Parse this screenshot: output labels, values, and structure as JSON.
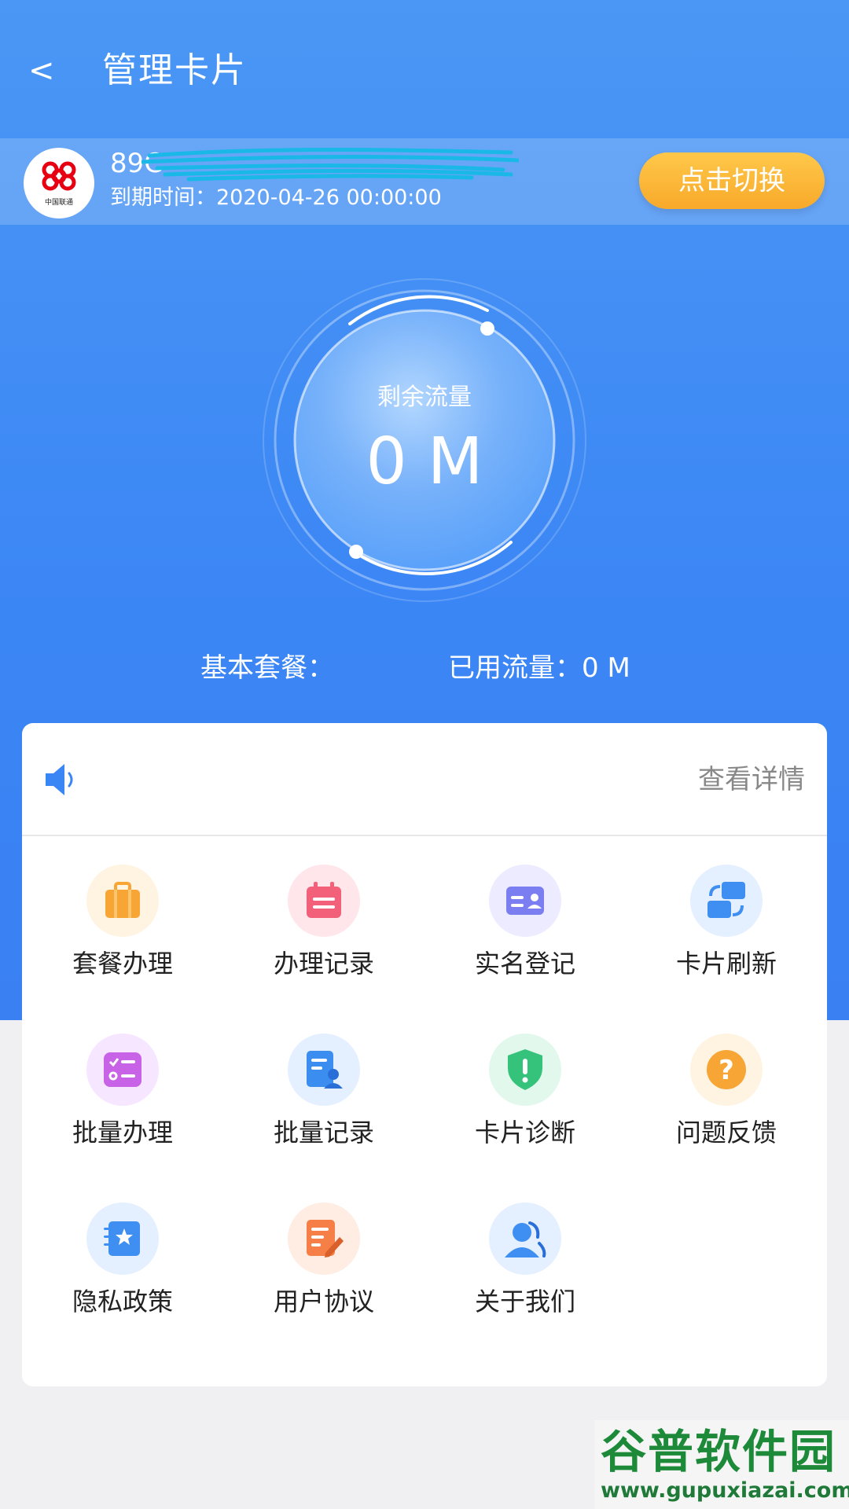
{
  "header": {
    "back": "<",
    "title": "管理卡片"
  },
  "card": {
    "carrier_logo_text": "中国联通",
    "number_visible": "89C",
    "expiry": "到期时间：2020-04-26 00:00:00",
    "switch_button": "点击切换"
  },
  "gauge": {
    "label": "剩余流量",
    "value": "0 M"
  },
  "stats": {
    "basic_plan": "基本套餐：",
    "used_traffic": "已用流量：0 M"
  },
  "notice": {
    "icon": "speaker-icon",
    "details_link": "查看详情"
  },
  "menu": [
    {
      "label": "套餐办理",
      "icon": "briefcase-icon",
      "color": "#f7a534"
    },
    {
      "label": "办理记录",
      "icon": "calendar-icon",
      "color": "#f2607a"
    },
    {
      "label": "实名登记",
      "icon": "id-card-icon",
      "color": "#7b7ef0"
    },
    {
      "label": "卡片刷新",
      "icon": "refresh-cards-icon",
      "color": "#3f8ff2"
    },
    {
      "label": "批量办理",
      "icon": "checklist-icon",
      "color": "#c862e6"
    },
    {
      "label": "批量记录",
      "icon": "document-user-icon",
      "color": "#3b8ef0"
    },
    {
      "label": "卡片诊断",
      "icon": "shield-alert-icon",
      "color": "#35c27a"
    },
    {
      "label": "问题反馈",
      "icon": "question-icon",
      "color": "#f7a534"
    },
    {
      "label": "隐私政策",
      "icon": "star-book-icon",
      "color": "#3f8ff2"
    },
    {
      "label": "用户协议",
      "icon": "edit-document-icon",
      "color": "#f57f46"
    },
    {
      "label": "关于我们",
      "icon": "users-icon",
      "color": "#3f8ff2"
    }
  ],
  "watermark": {
    "name": "谷普软件园",
    "url": "www.gupuxiazai.com"
  }
}
